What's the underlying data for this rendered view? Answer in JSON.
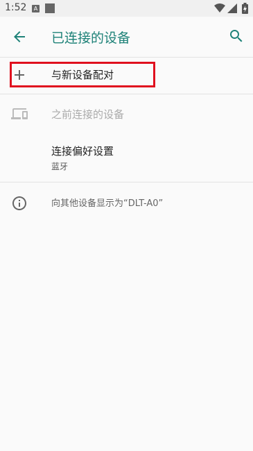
{
  "status_bar": {
    "time": "1:52",
    "notification_letter": "A"
  },
  "header": {
    "title": "已连接的设备"
  },
  "items": {
    "pair_new": {
      "label": "与新设备配对"
    },
    "previous_devices": {
      "label": "之前连接的设备"
    },
    "preferences": {
      "label": "连接偏好设置",
      "subtitle": "蓝牙"
    },
    "visible_as": {
      "label": "向其他设备显示为“DLT-A0”"
    }
  },
  "colors": {
    "accent": "#1e8278",
    "highlight": "#e0101e"
  },
  "icons": {
    "back": "arrow-left-icon",
    "search": "search-icon",
    "pair": "plus-icon",
    "previous": "devices-icon",
    "info": "info-icon"
  }
}
